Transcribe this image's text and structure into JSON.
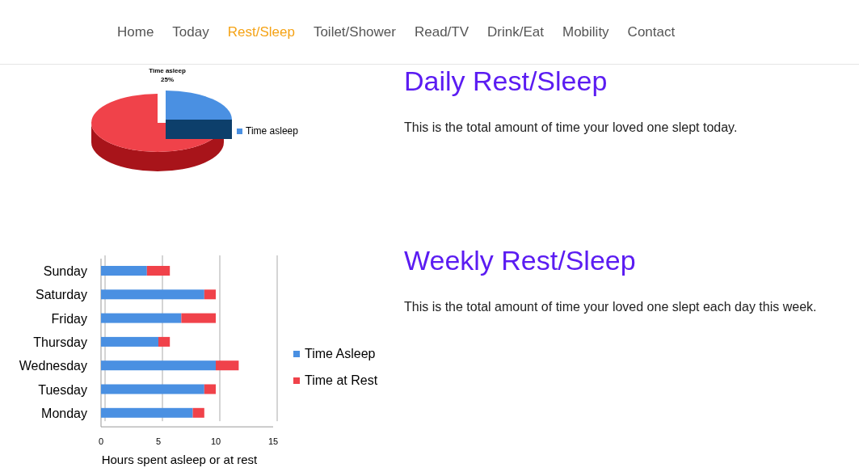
{
  "nav": [
    {
      "label": "Home",
      "selected": false
    },
    {
      "label": "Today",
      "selected": false
    },
    {
      "label": "Rest/Sleep",
      "selected": true
    },
    {
      "label": "Toilet/Shower",
      "selected": false
    },
    {
      "label": "Read/TV",
      "selected": false
    },
    {
      "label": "Drink/Eat",
      "selected": false
    },
    {
      "label": "Mobility",
      "selected": false
    },
    {
      "label": "Contact",
      "selected": false
    }
  ],
  "sections": [
    {
      "heading": "Daily Rest/Sleep",
      "text": "This is the total amount of time your loved one slept today.",
      "pie": {
        "kind": "pie",
        "slice_label": "Time asleep",
        "slice_value": "25%",
        "legend": "Time asleep"
      }
    },
    {
      "heading": "Weekly Rest/Sleep",
      "text": "This is the total amount of time your loved one slept each day this week.",
      "chart_data": {
        "type": "bar",
        "orientation": "horizontal",
        "stacked": true,
        "xlabel": "Hours spent asleep or at rest",
        "categories": [
          "Sunday",
          "Saturday",
          "Friday",
          "Thursday",
          "Wednesday",
          "Tuesday",
          "Monday"
        ],
        "series": [
          {
            "name": "Time Asleep",
            "color": "#4a90e2",
            "values": [
              4,
              9,
              7,
              5,
              10,
              9,
              8
            ]
          },
          {
            "name": "Time at Rest",
            "color": "#f0424a",
            "values": [
              2,
              1,
              3,
              1,
              2,
              1,
              1
            ]
          }
        ],
        "legend": true,
        "xlim": [
          0,
          15
        ],
        "xticks": [
          0,
          5,
          10,
          15
        ]
      }
    }
  ]
}
